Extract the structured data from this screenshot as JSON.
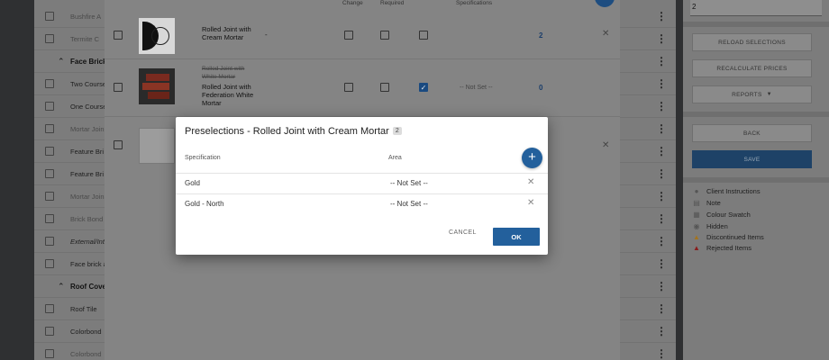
{
  "background_list": {
    "rows": [
      {
        "label": "Bushfire A",
        "style": "dim"
      },
      {
        "label": "Termite C",
        "style": "dim"
      },
      {
        "label": "Face Brick",
        "style": "group"
      },
      {
        "label": "Two Course",
        "style": "normal"
      },
      {
        "label": "One Course",
        "style": "normal"
      },
      {
        "label": "Mortar Join",
        "style": "dim"
      },
      {
        "label": "Feature Bri",
        "style": "normal"
      },
      {
        "label": "Feature Bri",
        "style": "normal"
      },
      {
        "label": "Mortar Join",
        "style": "dim"
      },
      {
        "label": "Brick Bond",
        "style": "dim"
      },
      {
        "label": "External/Int",
        "style": "italic"
      },
      {
        "label": "Face brick a",
        "style": "normal"
      },
      {
        "label": "Roof Cove",
        "style": "group"
      },
      {
        "label": "Roof Tile",
        "style": "normal"
      },
      {
        "label": "Colorbond",
        "style": "normal"
      },
      {
        "label": "Colorbond",
        "style": "dim"
      }
    ]
  },
  "panel": {
    "headers": {
      "change": "Change",
      "required": "Required",
      "specifications": "Specifications"
    },
    "rows": [
      {
        "strike": "",
        "name": "Rolled Joint with Cream Mortar",
        "dash": "-",
        "notset": "",
        "count": "2"
      },
      {
        "strike": "Rolled Joint with White Mortar",
        "name": "Rolled Joint with Federation White Mortar",
        "dash": "",
        "notset": "-- Not Set --",
        "count": "0"
      }
    ]
  },
  "sidebar": {
    "field_value": "2",
    "buttons": {
      "reload": "RELOAD SELECTIONS",
      "recalc": "RECALCULATE PRICES",
      "reports": "REPORTS",
      "back": "BACK",
      "save": "SAVE"
    },
    "legend": [
      {
        "label": "Client Instructions"
      },
      {
        "label": "Note"
      },
      {
        "label": "Colour Swatch"
      },
      {
        "label": "Hidden"
      },
      {
        "label": "Discontinued Items"
      },
      {
        "label": "Rejected Items"
      }
    ]
  },
  "modal": {
    "title": "Preselections - Rolled Joint with Cream Mortar",
    "badge": "2",
    "col_spec": "Specification",
    "col_area": "Area",
    "rows": [
      {
        "spec": "Gold",
        "area": "-- Not Set --"
      },
      {
        "spec": "Gold - North",
        "area": "-- Not Set --"
      }
    ],
    "cancel": "CANCEL",
    "ok": "OK"
  },
  "colors": {
    "primary": "#23609c",
    "save_dim": "#1e4267",
    "warn_orange": "#e0a030",
    "warn_red": "#c02020"
  }
}
